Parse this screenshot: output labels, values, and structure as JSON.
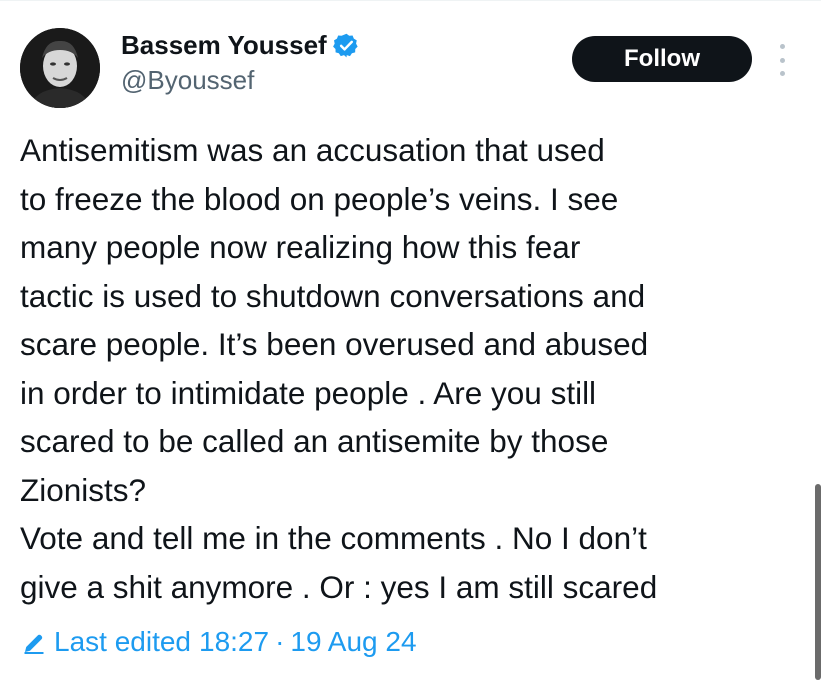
{
  "author": {
    "display_name": "Bassem Youssef",
    "handle": "@Byoussef",
    "avatar_icon": "profile-photo",
    "verified_icon": "verified-badge-icon",
    "verified_color": "#1d9bf0"
  },
  "actions": {
    "follow_label": "Follow",
    "more_icon": "more-options-icon"
  },
  "tweet": {
    "lines": [
      "Antisemitism was an accusation that used",
      "to freeze the blood on people’s veins. I see",
      "many people now realizing how this fear",
      "tactic is used to shutdown conversations and",
      "scare people. It’s been overused and abused",
      "in order to intimidate people . Are you still",
      "scared to be called an antisemite by those",
      "Zionists?",
      "Vote and tell me in the comments . No I don’t",
      "give a shit anymore . Or : yes I am still scared"
    ]
  },
  "edit_info": {
    "icon": "pencil-icon",
    "label": "Last edited",
    "time": "18:27",
    "separator": "·",
    "date": "19 Aug 24",
    "link_color": "#1d9bf0"
  },
  "colors": {
    "text_primary": "#0f1419",
    "text_secondary": "#536471",
    "button_bg": "#0f1419"
  }
}
